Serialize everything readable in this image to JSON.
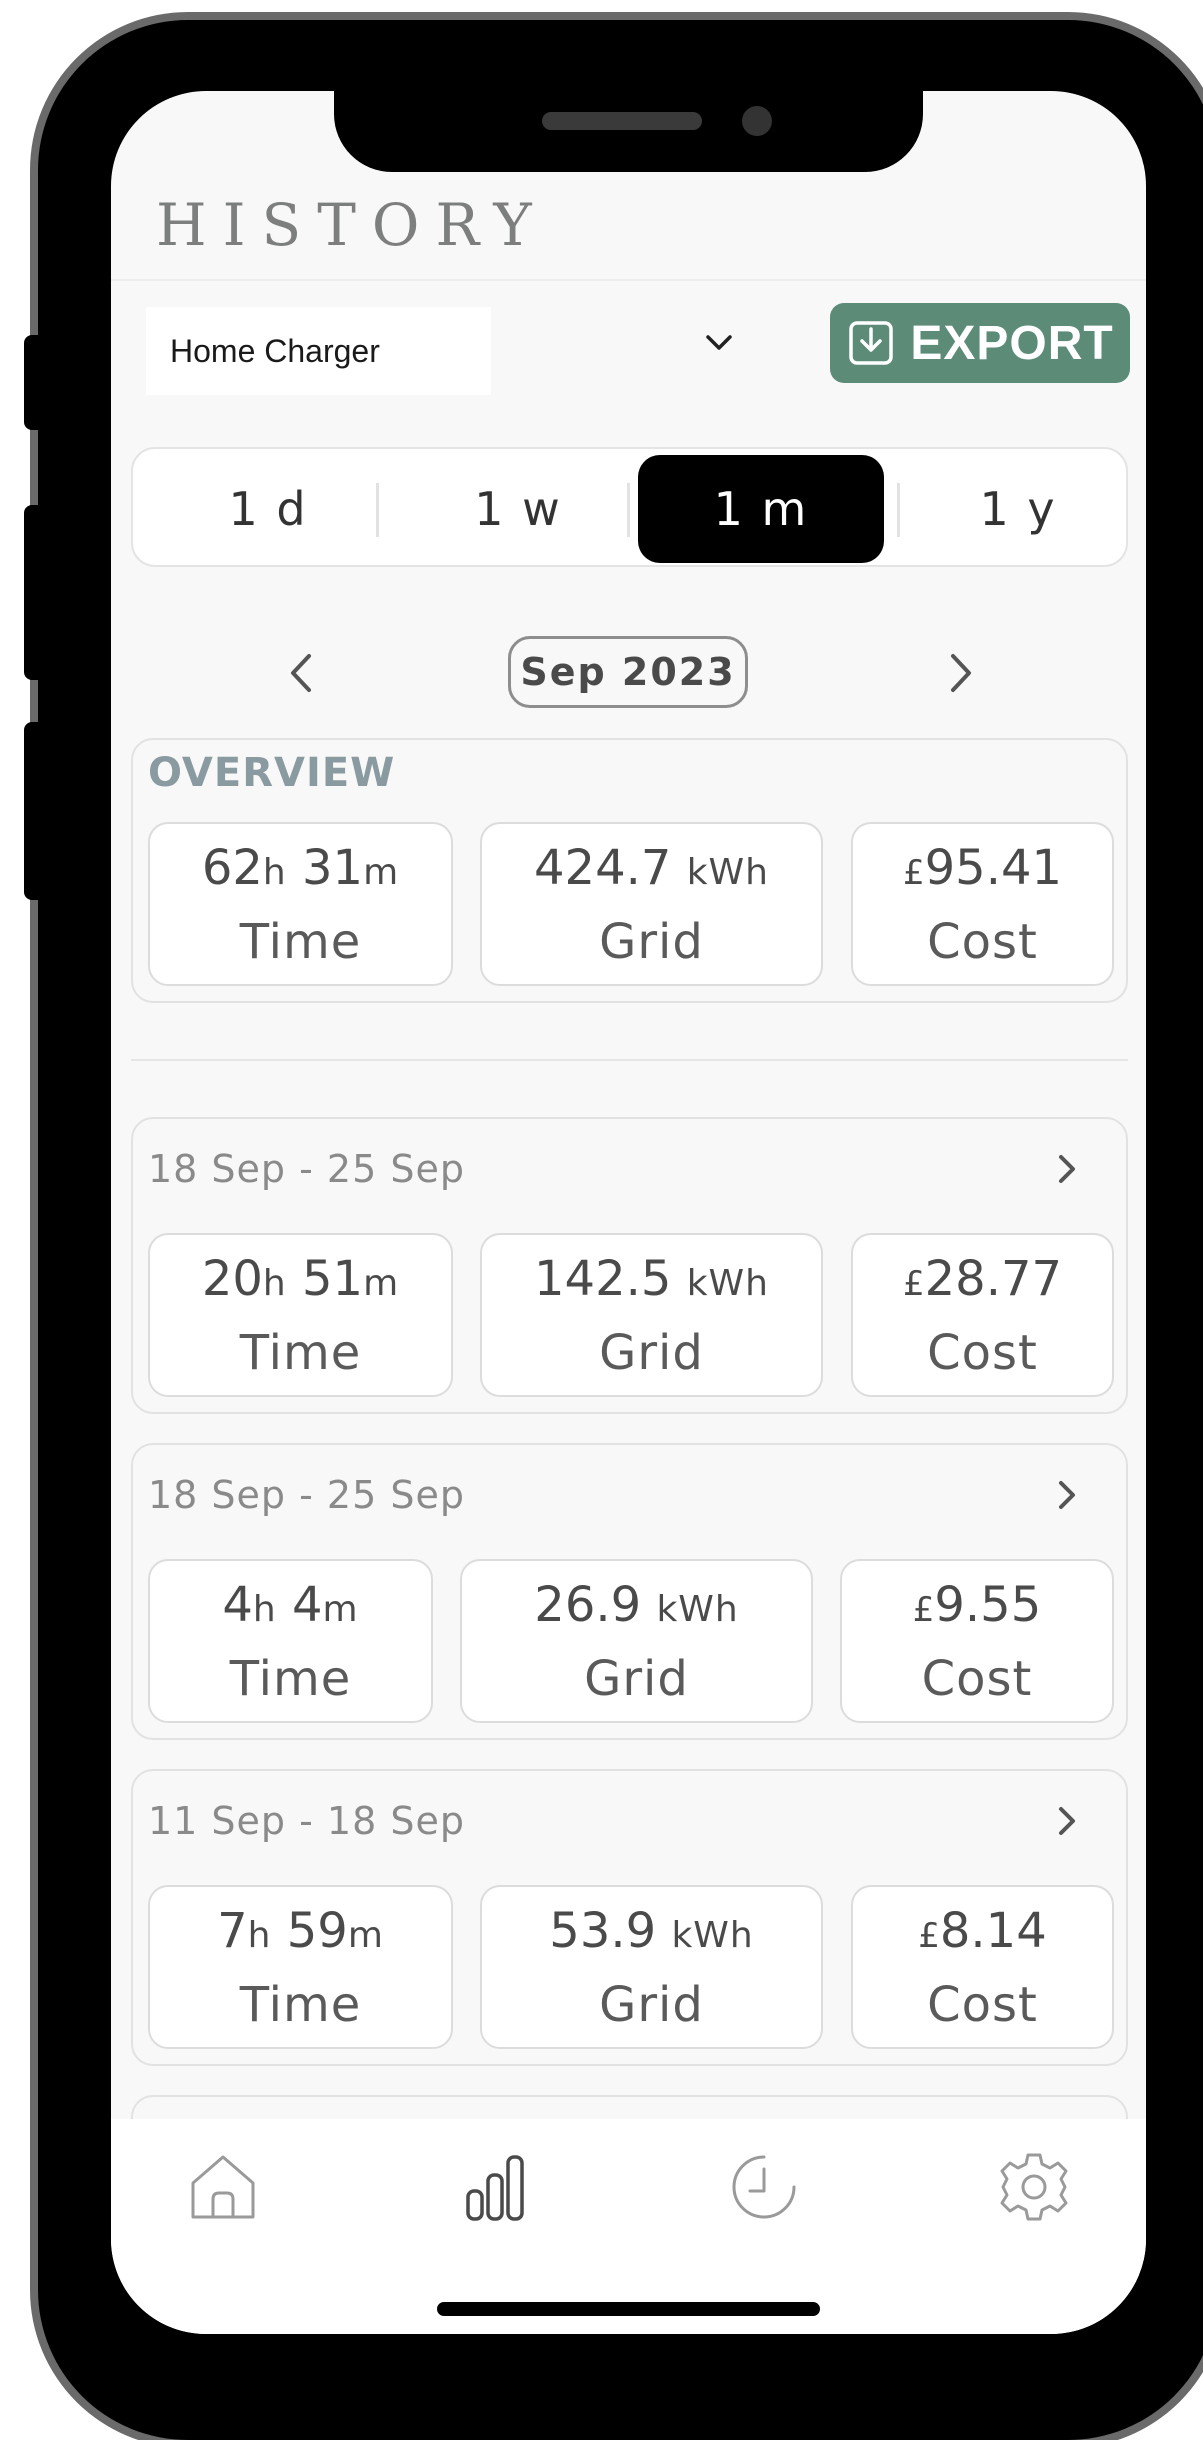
{
  "header": {
    "title": "HISTORY"
  },
  "toolbar": {
    "charger_name": "Home Charger",
    "export_label": "EXPORT"
  },
  "range_options": [
    {
      "label": "1 d",
      "active": false
    },
    {
      "label": "1 w",
      "active": false
    },
    {
      "label": "1 m",
      "active": true
    },
    {
      "label": "1 y",
      "active": false
    }
  ],
  "period": {
    "label": "Sep 2023"
  },
  "overview": {
    "label": "OVERVIEW",
    "time_hours": "62",
    "time_minutes": "31",
    "hours_unit": "h",
    "minutes_unit": "m",
    "time_caption": "Time",
    "grid_value": "424.7",
    "grid_unit": "kWh",
    "grid_caption": "Grid",
    "currency": "£",
    "cost_value": "95.41",
    "cost_caption": "Cost"
  },
  "entries": [
    {
      "range": "18 Sep - 25 Sep",
      "time_hours": "20",
      "time_minutes": "51",
      "hours_unit": "h",
      "minutes_unit": "m",
      "time_caption": "Time",
      "grid_value": "142.5",
      "grid_unit": "kWh",
      "grid_caption": "Grid",
      "currency": "£",
      "cost_value": "28.77",
      "cost_caption": "Cost"
    },
    {
      "range": "18 Sep - 25 Sep",
      "time_hours": "4",
      "time_minutes": "4",
      "hours_unit": "h",
      "minutes_unit": "m",
      "time_caption": "Time",
      "grid_value": "26.9",
      "grid_unit": "kWh",
      "grid_caption": "Grid",
      "currency": "£",
      "cost_value": "9.55",
      "cost_caption": "Cost"
    },
    {
      "range": "11 Sep - 18 Sep",
      "time_hours": "7",
      "time_minutes": "59",
      "hours_unit": "h",
      "minutes_unit": "m",
      "time_caption": "Time",
      "grid_value": "53.9",
      "grid_unit": "kWh",
      "grid_caption": "Grid",
      "currency": "£",
      "cost_value": "8.14",
      "cost_caption": "Cost"
    }
  ],
  "bottom_nav": {
    "items": [
      {
        "icon": "home-icon",
        "active": false
      },
      {
        "icon": "bar-chart-icon",
        "active": true
      },
      {
        "icon": "clock-icon",
        "active": false
      },
      {
        "icon": "settings-icon",
        "active": false
      }
    ]
  },
  "colors": {
    "accent": "#5c8b78",
    "overview_label": "#8a9aa1",
    "screen_background": "#f8f8f8"
  }
}
